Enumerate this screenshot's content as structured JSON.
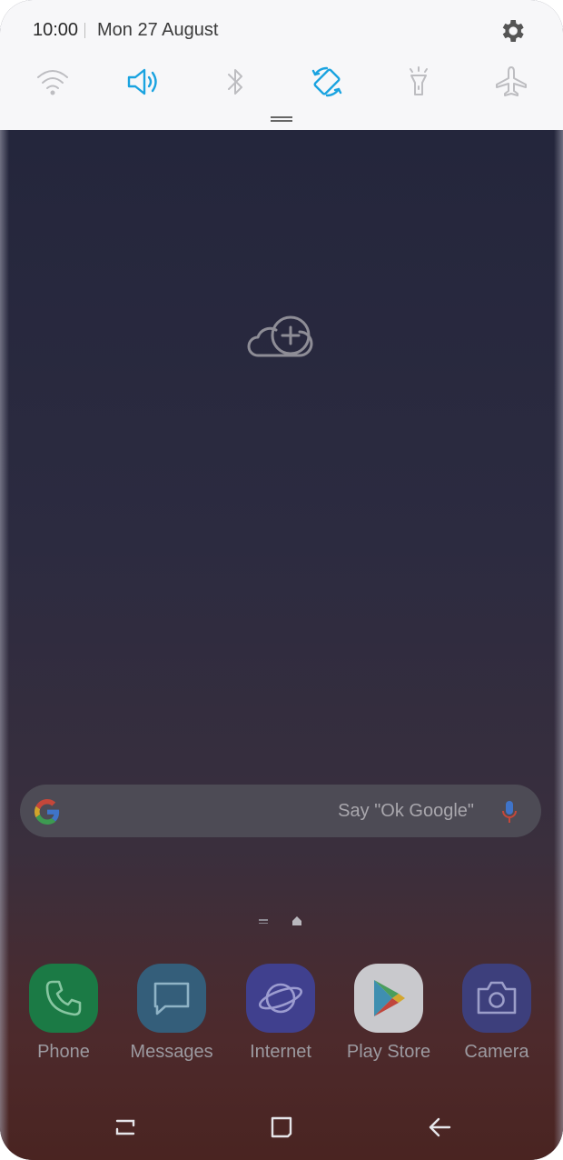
{
  "status": {
    "time": "10:00",
    "date": "Mon 27 August"
  },
  "colors": {
    "active_tile": "#1aa3e0",
    "inactive_tile": "#b8b8bc",
    "panel_bg": "#f7f7f9"
  },
  "quick_tiles": [
    {
      "name": "wifi-icon",
      "active": false
    },
    {
      "name": "sound-icon",
      "active": true
    },
    {
      "name": "bluetooth-icon",
      "active": false
    },
    {
      "name": "auto-rotate-icon",
      "active": true
    },
    {
      "name": "flashlight-icon",
      "active": false
    },
    {
      "name": "airplane-mode-icon",
      "active": false
    }
  ],
  "search": {
    "hint": "Say \"Ok Google\""
  },
  "dock": {
    "apps": [
      {
        "label": "Phone",
        "icon": "phone-icon",
        "color": "#1b7a45"
      },
      {
        "label": "Messages",
        "icon": "messages-icon",
        "color": "#355e7a"
      },
      {
        "label": "Internet",
        "icon": "internet-icon",
        "color": "#3f3f8c"
      },
      {
        "label": "Play Store",
        "icon": "play-store-icon",
        "color": "#c8c8cc"
      },
      {
        "label": "Camera",
        "icon": "camera-icon",
        "color": "#3d3f7c"
      }
    ]
  },
  "navigation": [
    "recent-apps",
    "home",
    "back"
  ]
}
